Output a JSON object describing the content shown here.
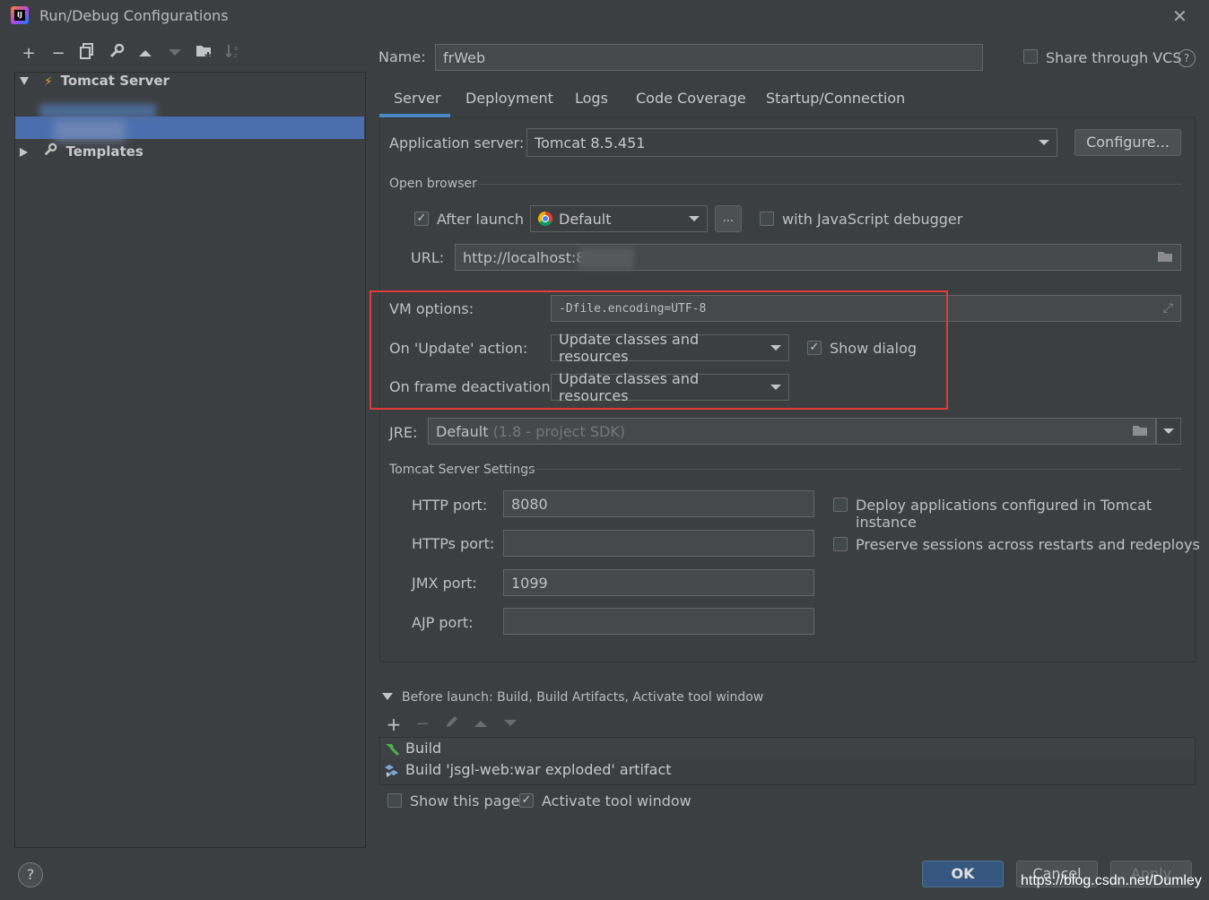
{
  "window": {
    "title": "Run/Debug Configurations"
  },
  "toolbar": {
    "icons": [
      "add-icon",
      "remove-icon",
      "copy-icon",
      "wrench-icon",
      "arrow-up-icon",
      "arrow-down-icon",
      "new-folder-icon",
      "sort-icon"
    ]
  },
  "tree": {
    "tomcat_server": "Tomcat Server",
    "templates": "Templates"
  },
  "name_row": {
    "label": "Name:",
    "value": "frWeb",
    "share_label": "Share through VCS",
    "share_checked": false
  },
  "tabs": [
    "Server",
    "Deployment",
    "Logs",
    "Code Coverage",
    "Startup/Connection"
  ],
  "server": {
    "app_server_label": "Application server:",
    "app_server_value": "Tomcat 8.5.451",
    "configure_button": "Configure...",
    "open_browser_section": "Open browser",
    "after_launch_label": "After launch",
    "after_launch_checked": true,
    "browser_value": "Default",
    "ellipsis_button": "...",
    "js_debugger_label": "with JavaScript debugger",
    "js_debugger_checked": false,
    "url_label": "URL:",
    "url_value": "http://localhost:80",
    "vm_options_label": "VM options:",
    "vm_options_value": "-Dfile.encoding=UTF-8",
    "on_update_label": "On 'Update' action:",
    "on_update_value": "Update classes and resources",
    "show_dialog_label": "Show dialog",
    "show_dialog_checked": true,
    "on_frame_label": "On frame deactivation:",
    "on_frame_value": "Update classes and resources",
    "jre_label": "JRE:",
    "jre_value": "Default",
    "jre_hint": "(1.8 - project SDK)",
    "tomcat_settings_section": "Tomcat Server Settings",
    "http_port_label": "HTTP port:",
    "http_port_value": "8080",
    "https_port_label": "HTTPs port:",
    "https_port_value": "",
    "jmx_port_label": "JMX port:",
    "jmx_port_value": "1099",
    "ajp_port_label": "AJP port:",
    "ajp_port_value": "",
    "deploy_label": "Deploy applications configured in Tomcat instance",
    "deploy_checked": false,
    "preserve_label": "Preserve sessions across restarts and redeploys",
    "preserve_checked": false
  },
  "before_launch": {
    "header": "Before launch: Build, Build Artifacts, Activate tool window",
    "items": [
      "Build",
      "Build 'jsgl-web:war exploded' artifact"
    ],
    "show_page_label": "Show this page",
    "show_page_checked": false,
    "activate_label": "Activate tool window",
    "activate_checked": true
  },
  "footer": {
    "help": "?",
    "ok": "OK",
    "cancel": "Cancel",
    "apply": "Apply",
    "watermark": "https://blog.csdn.net/Dumley"
  },
  "colors": {
    "background": "#3c3f41",
    "selection": "#4b6eaf",
    "highlight_box": "#e03b3b",
    "ok_button": "#365880"
  }
}
